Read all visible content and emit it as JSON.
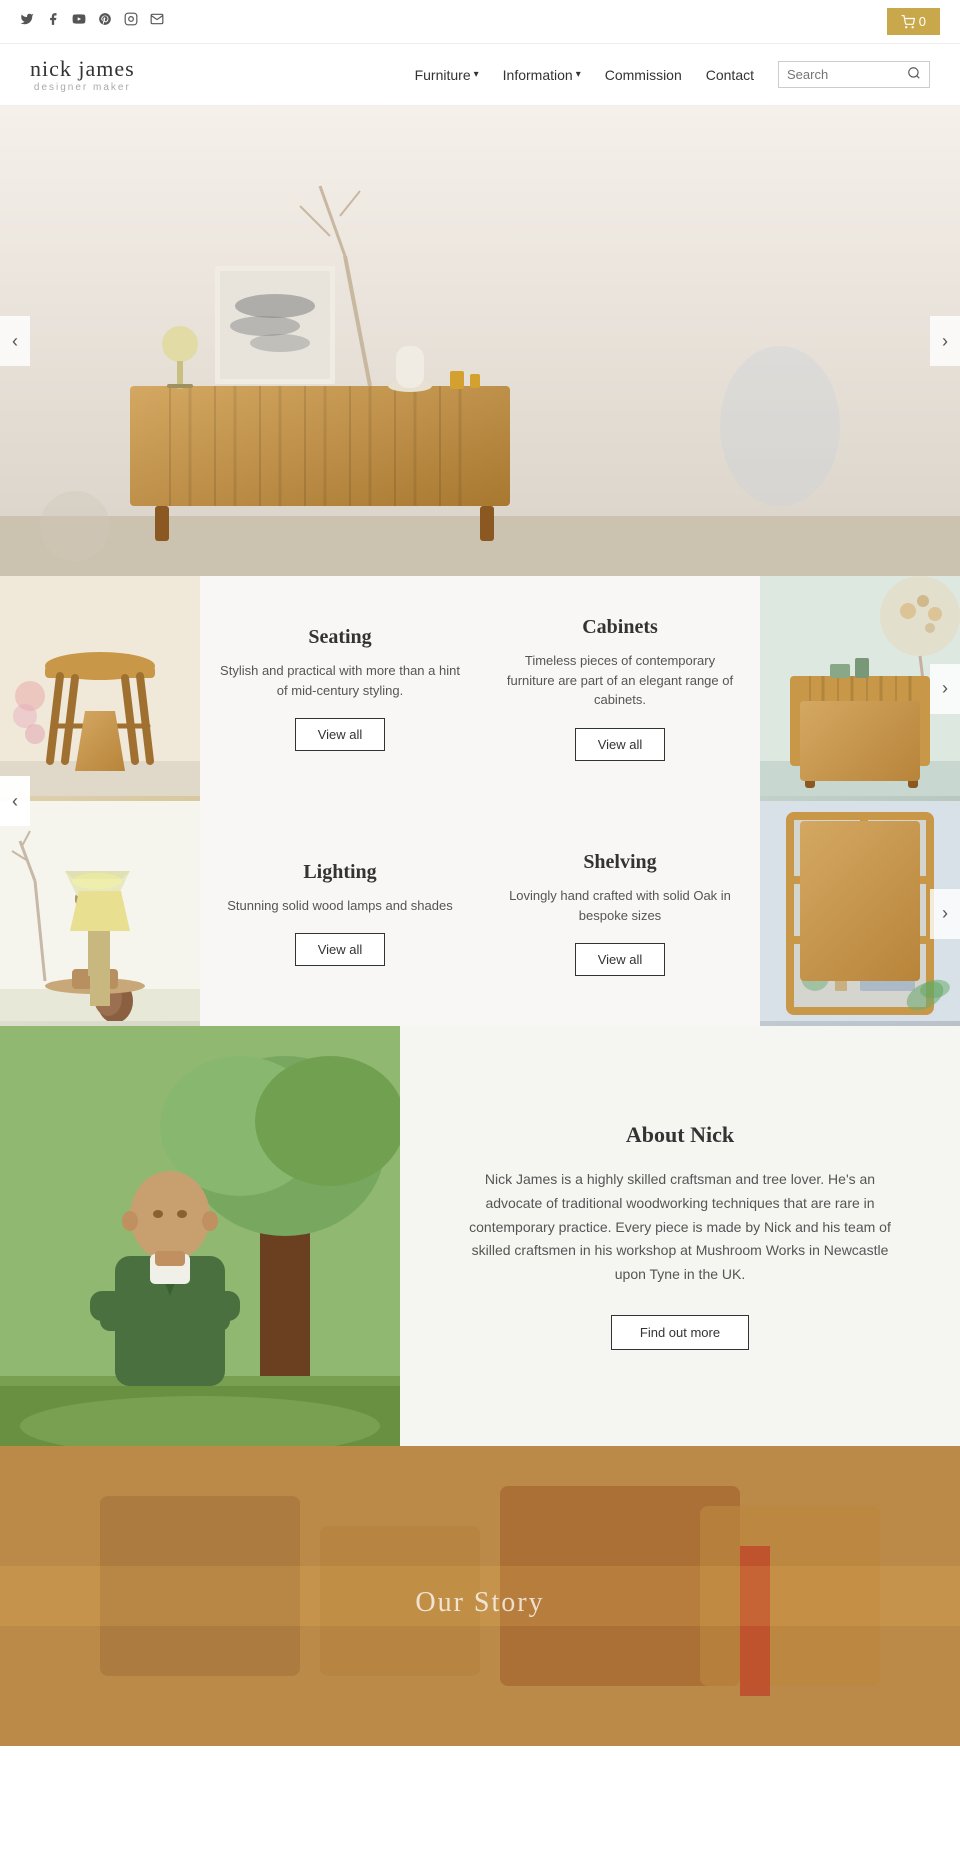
{
  "topbar": {
    "social": [
      {
        "name": "twitter",
        "symbol": "𝕋",
        "label": "Twitter"
      },
      {
        "name": "facebook",
        "symbol": "f",
        "label": "Facebook"
      },
      {
        "name": "youtube",
        "symbol": "▶",
        "label": "YouTube"
      },
      {
        "name": "pinterest",
        "symbol": "P",
        "label": "Pinterest"
      },
      {
        "name": "instagram",
        "symbol": "◎",
        "label": "Instagram"
      },
      {
        "name": "email",
        "symbol": "✉",
        "label": "Email"
      }
    ],
    "cart_count": "0",
    "cart_label": "0"
  },
  "header": {
    "logo_name": "nick james",
    "logo_sub": "designer maker",
    "nav": [
      {
        "label": "Furniture",
        "has_dropdown": true
      },
      {
        "label": "Information",
        "has_dropdown": true
      },
      {
        "label": "Commission",
        "has_dropdown": false
      },
      {
        "label": "Contact",
        "has_dropdown": false
      }
    ],
    "search_placeholder": "Search"
  },
  "hero": {
    "alt": "Nick James Furniture hero image showing wooden sideboard"
  },
  "categories": {
    "left_col": [
      {
        "title": "Seating",
        "description": "Stylish and practical with more than a hint of mid-century styling.",
        "view_all": "View all",
        "img_type": "stool"
      },
      {
        "title": "Lighting",
        "description": "Stunning solid wood lamps and shades",
        "view_all": "View all",
        "img_type": "lamp"
      }
    ],
    "right_col": [
      {
        "title": "Cabinets",
        "description": "Timeless pieces of contemporary furniture are part of an elegant range of cabinets.",
        "view_all": "View all",
        "img_type": "cabinet"
      },
      {
        "title": "Shelving",
        "description": "Lovingly hand crafted with solid Oak in bespoke sizes",
        "view_all": "View all",
        "img_type": "shelving"
      }
    ]
  },
  "about": {
    "title": "About Nick",
    "description": "Nick James is a highly skilled craftsman and tree lover. He's an advocate of traditional woodworking techniques that are rare in contemporary practice. Every piece is made by Nick and his team of skilled craftsmen in his workshop at Mushroom Works in Newcastle upon Tyne in the UK.",
    "find_out_btn": "Find out more"
  },
  "bottom_banner": {
    "alt": "Workshop blurred background"
  }
}
